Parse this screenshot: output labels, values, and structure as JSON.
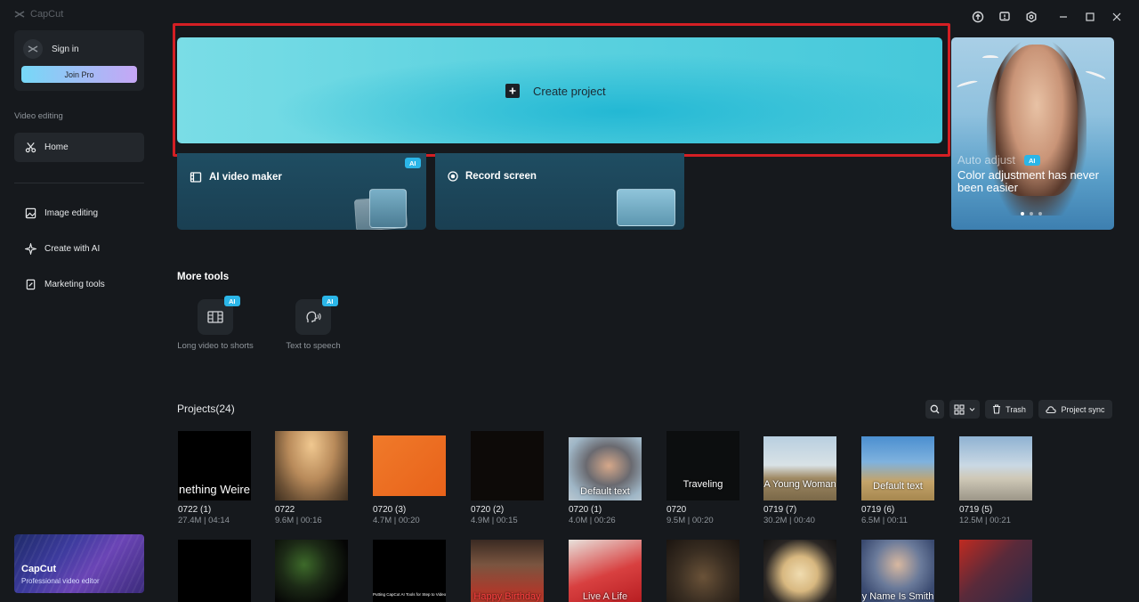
{
  "app": {
    "name": "CapCut"
  },
  "sidebar": {
    "sign_in": "Sign in",
    "join_pro": "Join Pro",
    "section_label": "Video editing",
    "items": [
      {
        "label": "Home",
        "icon": "scissors-icon"
      },
      {
        "label": "Image editing",
        "icon": "image-icon"
      },
      {
        "label": "Create with AI",
        "icon": "sparkle-icon"
      },
      {
        "label": "Marketing tools",
        "icon": "clipboard-icon"
      }
    ],
    "promo": {
      "title": "CapCut",
      "subtitle": "Professional video editor"
    }
  },
  "main": {
    "create_project": "Create project",
    "tools": [
      {
        "label": "AI video maker",
        "badge": "AI"
      },
      {
        "label": "Record screen"
      }
    ],
    "banner": {
      "subtitle": "Auto adjust",
      "badge": "AI",
      "title": "Color adjustment has never been easier"
    },
    "more_tools": {
      "title": "More tools",
      "items": [
        {
          "label": "Long video to shorts",
          "badge": "AI"
        },
        {
          "label": "Text to speech",
          "badge": "AI"
        }
      ]
    }
  },
  "projects": {
    "title": "Projects(24)",
    "trash": "Trash",
    "sync": "Project sync",
    "items": [
      {
        "name": "0722 (1)",
        "meta": "27.4M | 04:14",
        "overlay": "nething Weire"
      },
      {
        "name": "0722",
        "meta": "9.6M | 00:16",
        "overlay": ""
      },
      {
        "name": "0720 (3)",
        "meta": "4.7M | 00:20",
        "overlay": ""
      },
      {
        "name": "0720 (2)",
        "meta": "4.9M | 00:15",
        "overlay": ""
      },
      {
        "name": "0720 (1)",
        "meta": "4.0M | 00:26",
        "overlay": "Default text"
      },
      {
        "name": "0720",
        "meta": "9.5M | 00:20",
        "overlay": "Traveling"
      },
      {
        "name": "0719 (7)",
        "meta": "30.2M | 00:40",
        "overlay": "A Young Woman"
      },
      {
        "name": "0719 (6)",
        "meta": "6.5M | 00:11",
        "overlay": "Default text"
      },
      {
        "name": "0719 (5)",
        "meta": "12.5M | 00:21",
        "overlay": ""
      }
    ],
    "row2_overlays": [
      "",
      "",
      "Putting CapCut AI Tools for Step to Video",
      "Happy Birthday",
      "Live A Life",
      "",
      "",
      "y Name Is Smith",
      ""
    ]
  }
}
